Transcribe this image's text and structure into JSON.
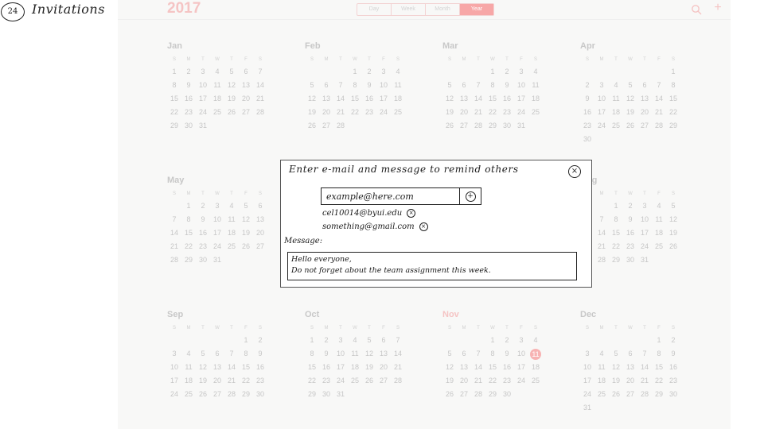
{
  "page": {
    "number": "24",
    "title": "Invitations"
  },
  "calendar": {
    "year": "2017",
    "views": [
      "Day",
      "Week",
      "Month",
      "Year"
    ],
    "active_view": "Year",
    "weekday_letters": [
      "S",
      "M",
      "T",
      "W",
      "T",
      "F",
      "S"
    ],
    "today": {
      "month": "Nov",
      "day": "11"
    },
    "months": [
      {
        "name": "Jan",
        "weeks": [
          [
            "1",
            "2",
            "3",
            "4",
            "5",
            "6",
            "7"
          ],
          [
            "8",
            "9",
            "10",
            "11",
            "12",
            "13",
            "14"
          ],
          [
            "15",
            "16",
            "17",
            "18",
            "19",
            "20",
            "21"
          ],
          [
            "22",
            "23",
            "24",
            "25",
            "26",
            "27",
            "28"
          ],
          [
            "29",
            "30",
            "31",
            "",
            "",
            "",
            ""
          ]
        ]
      },
      {
        "name": "Feb",
        "weeks": [
          [
            "",
            "",
            "",
            "1",
            "2",
            "3",
            "4"
          ],
          [
            "5",
            "6",
            "7",
            "8",
            "9",
            "10",
            "11"
          ],
          [
            "12",
            "13",
            "14",
            "15",
            "16",
            "17",
            "18"
          ],
          [
            "19",
            "20",
            "21",
            "22",
            "23",
            "24",
            "25"
          ],
          [
            "26",
            "27",
            "28",
            "",
            "",
            "",
            ""
          ]
        ]
      },
      {
        "name": "Mar",
        "weeks": [
          [
            "",
            "",
            "",
            "1",
            "2",
            "3",
            "4"
          ],
          [
            "5",
            "6",
            "7",
            "8",
            "9",
            "10",
            "11"
          ],
          [
            "12",
            "13",
            "14",
            "15",
            "16",
            "17",
            "18"
          ],
          [
            "19",
            "20",
            "21",
            "22",
            "23",
            "24",
            "25"
          ],
          [
            "26",
            "27",
            "28",
            "29",
            "30",
            "31",
            ""
          ]
        ]
      },
      {
        "name": "Apr",
        "weeks": [
          [
            "",
            "",
            "",
            "",
            "",
            "",
            "1"
          ],
          [
            "2",
            "3",
            "4",
            "5",
            "6",
            "7",
            "8"
          ],
          [
            "9",
            "10",
            "11",
            "12",
            "13",
            "14",
            "15"
          ],
          [
            "16",
            "17",
            "18",
            "19",
            "20",
            "21",
            "22"
          ],
          [
            "23",
            "24",
            "25",
            "26",
            "27",
            "28",
            "29"
          ],
          [
            "30",
            "",
            "",
            "",
            "",
            "",
            ""
          ]
        ]
      },
      {
        "name": "May",
        "weeks": [
          [
            "",
            "1",
            "2",
            "3",
            "4",
            "5",
            "6"
          ],
          [
            "7",
            "8",
            "9",
            "10",
            "11",
            "12",
            "13"
          ],
          [
            "14",
            "15",
            "16",
            "17",
            "18",
            "19",
            "20"
          ],
          [
            "21",
            "22",
            "23",
            "24",
            "25",
            "26",
            "27"
          ],
          [
            "28",
            "29",
            "30",
            "31",
            "",
            "",
            ""
          ]
        ]
      },
      {
        "name": "Aug",
        "weeks": [
          [
            "",
            "",
            "1",
            "2",
            "3",
            "4",
            "5"
          ],
          [
            "6",
            "7",
            "8",
            "9",
            "10",
            "11",
            "12"
          ],
          [
            "13",
            "14",
            "15",
            "16",
            "17",
            "18",
            "19"
          ],
          [
            "20",
            "21",
            "22",
            "23",
            "24",
            "25",
            "26"
          ],
          [
            "27",
            "28",
            "29",
            "30",
            "31",
            "",
            ""
          ]
        ]
      },
      {
        "name": "Sep",
        "weeks": [
          [
            "",
            "",
            "",
            "",
            "",
            "1",
            "2"
          ],
          [
            "3",
            "4",
            "5",
            "6",
            "7",
            "8",
            "9"
          ],
          [
            "10",
            "11",
            "12",
            "13",
            "14",
            "15",
            "16"
          ],
          [
            "17",
            "18",
            "19",
            "20",
            "21",
            "22",
            "23"
          ],
          [
            "24",
            "25",
            "26",
            "27",
            "28",
            "29",
            "30"
          ]
        ]
      },
      {
        "name": "Oct",
        "weeks": [
          [
            "1",
            "2",
            "3",
            "4",
            "5",
            "6",
            "7"
          ],
          [
            "8",
            "9",
            "10",
            "11",
            "12",
            "13",
            "14"
          ],
          [
            "15",
            "16",
            "17",
            "18",
            "19",
            "20",
            "21"
          ],
          [
            "22",
            "23",
            "24",
            "25",
            "26",
            "27",
            "28"
          ],
          [
            "29",
            "30",
            "31",
            "",
            "",
            "",
            ""
          ]
        ]
      },
      {
        "name": "Nov",
        "weeks": [
          [
            "",
            "",
            "",
            "1",
            "2",
            "3",
            "4"
          ],
          [
            "5",
            "6",
            "7",
            "8",
            "9",
            "10",
            "11"
          ],
          [
            "12",
            "13",
            "14",
            "15",
            "16",
            "17",
            "18"
          ],
          [
            "19",
            "20",
            "21",
            "22",
            "23",
            "24",
            "25"
          ],
          [
            "26",
            "27",
            "28",
            "29",
            "30",
            "",
            ""
          ]
        ]
      },
      {
        "name": "Dec",
        "weeks": [
          [
            "",
            "",
            "",
            "",
            "",
            "1",
            "2"
          ],
          [
            "3",
            "4",
            "5",
            "6",
            "7",
            "8",
            "9"
          ],
          [
            "10",
            "11",
            "12",
            "13",
            "14",
            "15",
            "16"
          ],
          [
            "17",
            "18",
            "19",
            "20",
            "21",
            "22",
            "23"
          ],
          [
            "24",
            "25",
            "26",
            "27",
            "28",
            "29",
            "30"
          ],
          [
            "31",
            "",
            "",
            "",
            "",
            "",
            ""
          ]
        ]
      }
    ]
  },
  "dialog": {
    "title": "Enter e-mail and message to remind others",
    "close_icon": "close-circle-icon",
    "email_placeholder": "example@here.com",
    "add_icon": "plus-circle-icon",
    "recipients": [
      "cel10014@byui.edu",
      "something@gmail.com"
    ],
    "message_label": "Message:",
    "message_lines": [
      "Hello everyone,",
      "Do not forget about the team assignment this week."
    ]
  }
}
